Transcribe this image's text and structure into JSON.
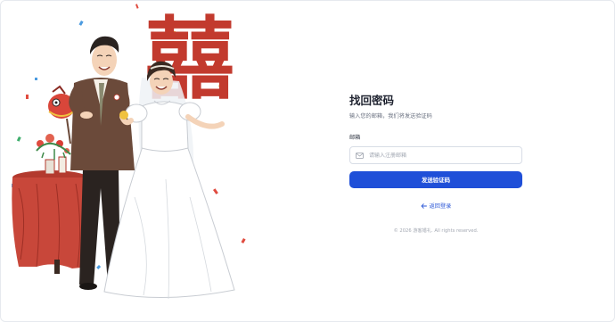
{
  "illustration": {
    "description_icon": "wedding-couple-illustration",
    "banner_char": "囍",
    "colors": {
      "red": "#c23a2e",
      "suit": "#6b4a3a",
      "dress": "#ffffff"
    }
  },
  "form": {
    "title": "找回密码",
    "subtitle": "输入您的邮箱，我们将发送验证码",
    "email_label": "邮箱",
    "email_placeholder": "请输入注册邮箱",
    "email_value": "",
    "email_icon": "mail-icon",
    "submit_label": "发送验证码",
    "back_icon": "arrow-left-icon",
    "back_label": "返回登录",
    "footer": "© 2026 游客婚礼. All rights reserved."
  },
  "colors": {
    "primary": "#1f4fd8",
    "link": "#2a56d6",
    "text": "#1f2330",
    "muted": "#6a7180"
  }
}
